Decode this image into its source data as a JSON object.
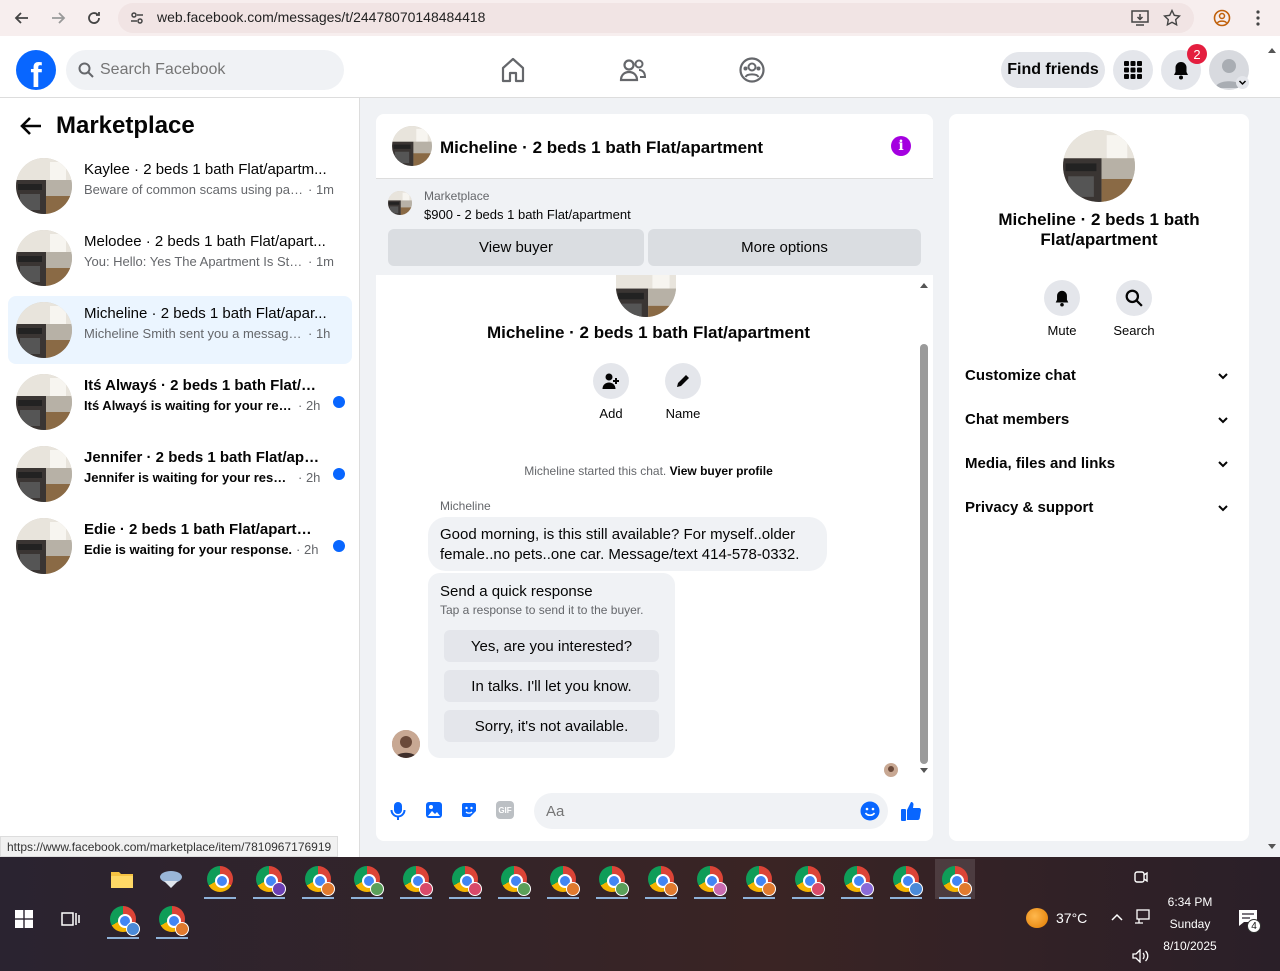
{
  "browser": {
    "url": "web.facebook.com/messages/t/24478070148484418"
  },
  "topbar": {
    "logo": "f",
    "search_placeholder": "Search Facebook",
    "find_friends": "Find friends",
    "notification_count": "2"
  },
  "sidebar": {
    "title": "Marketplace",
    "conversations": [
      {
        "name": "Kaylee · 2 beds 1 bath Flat/apartm...",
        "snippet": "Beware of common scams using pay...",
        "time": "· 1m",
        "unread": false
      },
      {
        "name": "Melodee · 2 beds 1 bath Flat/apart...",
        "snippet": "You: Hello: Yes The Apartment Is Still ...",
        "time": "· 1m",
        "unread": false
      },
      {
        "name": "Micheline · 2 beds 1 bath Flat/apar...",
        "snippet": "Micheline Smith sent you a message a...",
        "time": "· 1h",
        "unread": false
      },
      {
        "name": "Itś Alwayś · 2 beds 1 bath Flat/ap...",
        "snippet": "Itś Alwayś is waiting for your resp...",
        "time": "· 2h",
        "unread": true
      },
      {
        "name": "Jennifer · 2 beds 1 bath Flat/apar...",
        "snippet": "Jennifer is waiting for your respon...",
        "time": "· 2h",
        "unread": true
      },
      {
        "name": "Edie · 2 beds 1 bath Flat/apartme...",
        "snippet": "Edie is waiting for your response.",
        "time": "· 2h",
        "unread": true
      }
    ],
    "status_url": "https://www.facebook.com/marketplace/item/7810967176919"
  },
  "chat": {
    "title": "Micheline · 2 beds 1 bath Flat/apartment",
    "marketplace_label": "Marketplace",
    "listing": "$900 - 2 beds 1 bath Flat/apartment",
    "view_buyer": "View buyer",
    "more_options": "More options",
    "profile_name": "Micheline · 2 beds 1 bath Flat/apartment",
    "add_label": "Add",
    "name_label": "Name",
    "started_text": "Micheline started this chat.",
    "view_buyer_profile": "View buyer profile",
    "sender": "Micheline",
    "message": "Good morning, is this still available? For myself..older female..no pets..one car. Message/text 414-578-0332.",
    "quick_title": "Send a quick response",
    "quick_sub": "Tap a response to send it to the buyer.",
    "quick_responses": [
      "Yes, are you interested?",
      "In talks. I'll let you know.",
      "Sorry, it's not available."
    ],
    "input_placeholder": "Aa"
  },
  "info_panel": {
    "title": "Micheline · 2 beds 1 bath Flat/apartment",
    "mute": "Mute",
    "search": "Search",
    "sections": [
      "Customize chat",
      "Chat members",
      "Media, files and links",
      "Privacy & support"
    ]
  },
  "taskbar": {
    "temperature": "37°C",
    "time": "6:34 PM",
    "day": "Sunday",
    "date": "8/10/2025",
    "notification_count": "4"
  },
  "colors": {
    "fb_blue": "#0866ff",
    "badge_red": "#e41e3f",
    "active_bg": "#ebf5ff",
    "info_purple": "#a400e0"
  }
}
